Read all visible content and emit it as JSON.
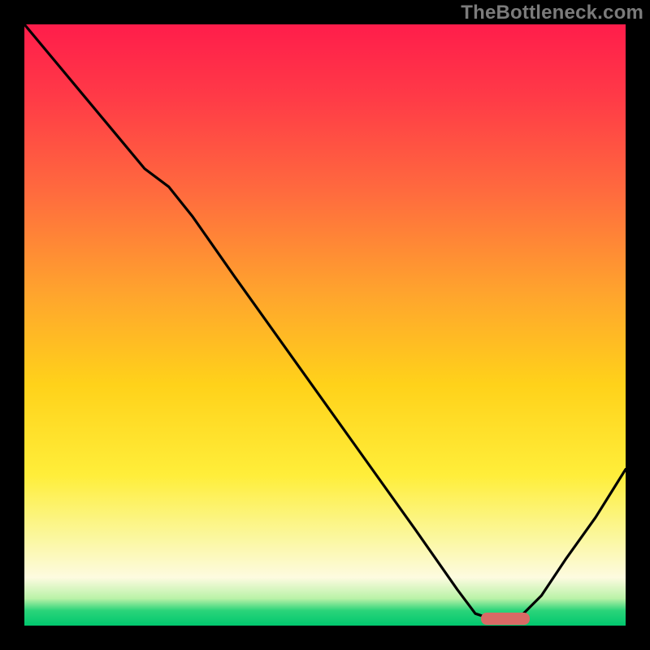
{
  "watermark": "TheBottleneck.com",
  "colors": {
    "frame_bg": "#000000",
    "watermark_text": "#7b7b7b",
    "marker_fill": "#d86a65",
    "curve_stroke": "#000000",
    "gradient_stops": [
      "#ff1d4b",
      "#ff3a47",
      "#ff6b3e",
      "#ffa52d",
      "#ffd21a",
      "#ffee3a",
      "#fbf79b",
      "#fdfbe0",
      "#b9f2a7",
      "#2bd47a",
      "#00c76e"
    ]
  },
  "chart_data": {
    "type": "line",
    "title": "",
    "xlabel": "",
    "ylabel": "",
    "xlim": [
      0,
      100
    ],
    "ylim": [
      0,
      100
    ],
    "note": "Background shows a vertical heat gradient (red top → green bottom) with a single bottleneck-style curve and a red marker pill at the curve minimum.",
    "series": [
      {
        "name": "bottleneck-curve",
        "x": [
          0,
          5,
          10,
          15,
          20,
          24,
          28,
          35,
          45,
          55,
          65,
          72,
          75,
          78,
          82,
          86,
          90,
          95,
          100
        ],
        "y": [
          100,
          94,
          88,
          82,
          76,
          73,
          68,
          58,
          44,
          30,
          16,
          6,
          2,
          1,
          1,
          5,
          11,
          18,
          26
        ]
      }
    ],
    "marker": {
      "x_center": 80,
      "y": 1,
      "width_pct": 8
    }
  }
}
